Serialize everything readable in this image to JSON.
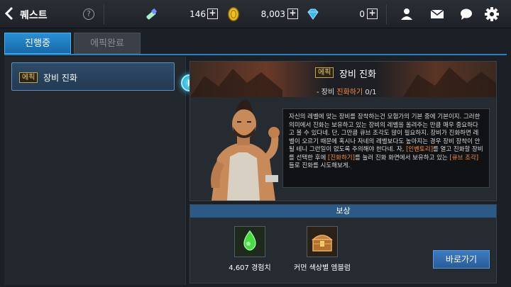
{
  "header": {
    "title": "퀘스트",
    "help": "?",
    "resource_1": "146",
    "resource_2": "8,003",
    "resource_3": "0",
    "plus": "+"
  },
  "tabs": [
    {
      "label": "진행중",
      "active": true
    },
    {
      "label": "에픽완료",
      "active": false
    }
  ],
  "quest_list": [
    {
      "badge": "에픽",
      "name": "장비 진화"
    }
  ],
  "quest_detail": {
    "badge": "에픽",
    "title": "장비 진화",
    "objective_prefix": "- 장비 ",
    "objective_highlight": "진화하기",
    "objective_progress": " 0/1",
    "dialog_1": "자신의 레벨에 맞는 장비를 장착하는건 모험가의 기본 중에 기본이지. 그러한 의미에서 진화는 보유하고 있는 장비의 레벨을 올려주는 만큼 매우 중요하다고 볼 수 있다네. 단, 그만큼 큐브 조각도 많이 필요하지. 장비가 진화하면 레벨이 오르기 때문에 혹시나 자네의 레벨보다도 높아지는 경우 장비 장착이 안될 테니 그런일이 없도록 주의해야 한다네. 자, ",
    "dialog_hl_1": "[인벤토리]",
    "dialog_2": "를 열고 진화할 장비를 선택한 후에 ",
    "dialog_hl_2": "[진화하기]",
    "dialog_3": "를 눌러 진화 화면에서 보유하고 있는 ",
    "dialog_hl_3": "[큐브 조각]",
    "dialog_4": "들로 진화를 시도해보게."
  },
  "reward": {
    "header": "보상",
    "items": [
      {
        "label": "4,607 경험치",
        "icon": "green-potion-icon"
      },
      {
        "label": "커먼 색상별 엠블럼",
        "icon": "treasure-chest-icon"
      }
    ],
    "go_button": "바로가기"
  },
  "colors": {
    "accent": "#2a8fd6",
    "highlight": "#ff8c3a",
    "badge": "#f0c860"
  }
}
